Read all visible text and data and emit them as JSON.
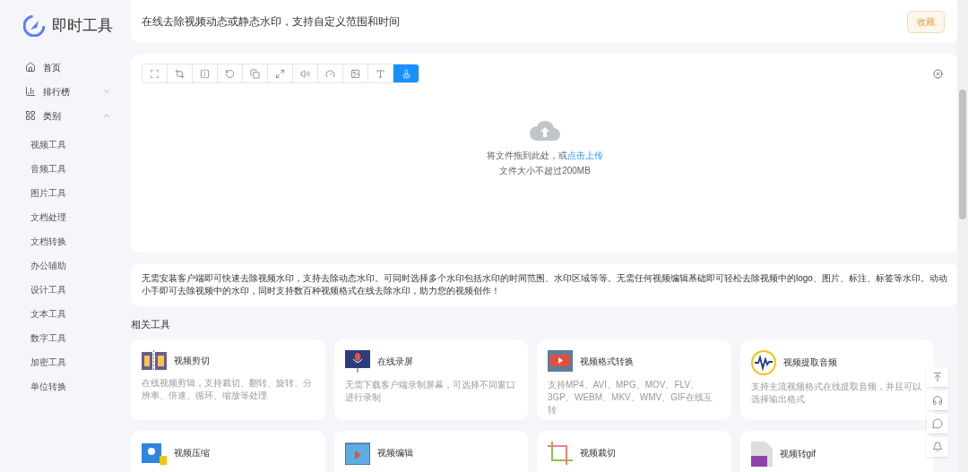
{
  "brand": {
    "name": "即时工具"
  },
  "nav": [
    {
      "label": "首页"
    },
    {
      "label": "排行榜",
      "expanded": false
    },
    {
      "label": "类别",
      "expanded": true,
      "children": [
        {
          "label": "视频工具"
        },
        {
          "label": "音频工具"
        },
        {
          "label": "图片工具"
        },
        {
          "label": "文档处理"
        },
        {
          "label": "文档转换"
        },
        {
          "label": "办公辅助"
        },
        {
          "label": "设计工具"
        },
        {
          "label": "文本工具"
        },
        {
          "label": "数字工具"
        },
        {
          "label": "加密工具"
        },
        {
          "label": "单位转换"
        }
      ]
    }
  ],
  "header": {
    "title": "在线去除视频动态或静态水印，支持自定义范围和时间",
    "favorite_button": "收藏"
  },
  "toolbar": [
    {
      "selected": false
    },
    {
      "selected": false
    },
    {
      "selected": false
    },
    {
      "selected": false
    },
    {
      "selected": false
    },
    {
      "selected": false
    },
    {
      "selected": false
    },
    {
      "selected": false
    },
    {
      "selected": false
    },
    {
      "selected": false
    },
    {
      "selected": true
    }
  ],
  "upload": {
    "prompt": "将文件拖到此处，或",
    "link": "点击上传",
    "hint": "文件大小不超过200MB"
  },
  "description": "无需安装客户端即可快速去除视频水印，支持去除动态水印。可同时选择多个水印包括水印的时间范围、水印区域等等。无需任何视频编辑基础即可轻松去除视频中的logo、图片、标注、标签等水印。动动小手即可去除视频中的水印，同时支持数百种视频格式在线去除水印，助力您的视频创作！",
  "related": {
    "title": "相关工具",
    "tools": [
      {
        "name": "视频剪切",
        "desc": "在线视频剪辑，支持裁切、翻转、旋转、分辨率、倍速、循环、缩放等处理"
      },
      {
        "name": "在线录屏",
        "desc": "无需下载客户端录制屏幕，可选择不同窗口进行录制"
      },
      {
        "name": "视频格式转换",
        "desc": "支持MP4、AVI、MPG、MOV、FLV、3GP、WEBM、MKV、WMV、GIF在线互转"
      },
      {
        "name": "视频提取音频",
        "desc": "支持主流视频格式在线提取音频，并且可以选择输出格式"
      },
      {
        "name": "视频压缩"
      },
      {
        "name": "视频编辑"
      },
      {
        "name": "视频裁切"
      },
      {
        "name": "视频转gif"
      }
    ]
  }
}
